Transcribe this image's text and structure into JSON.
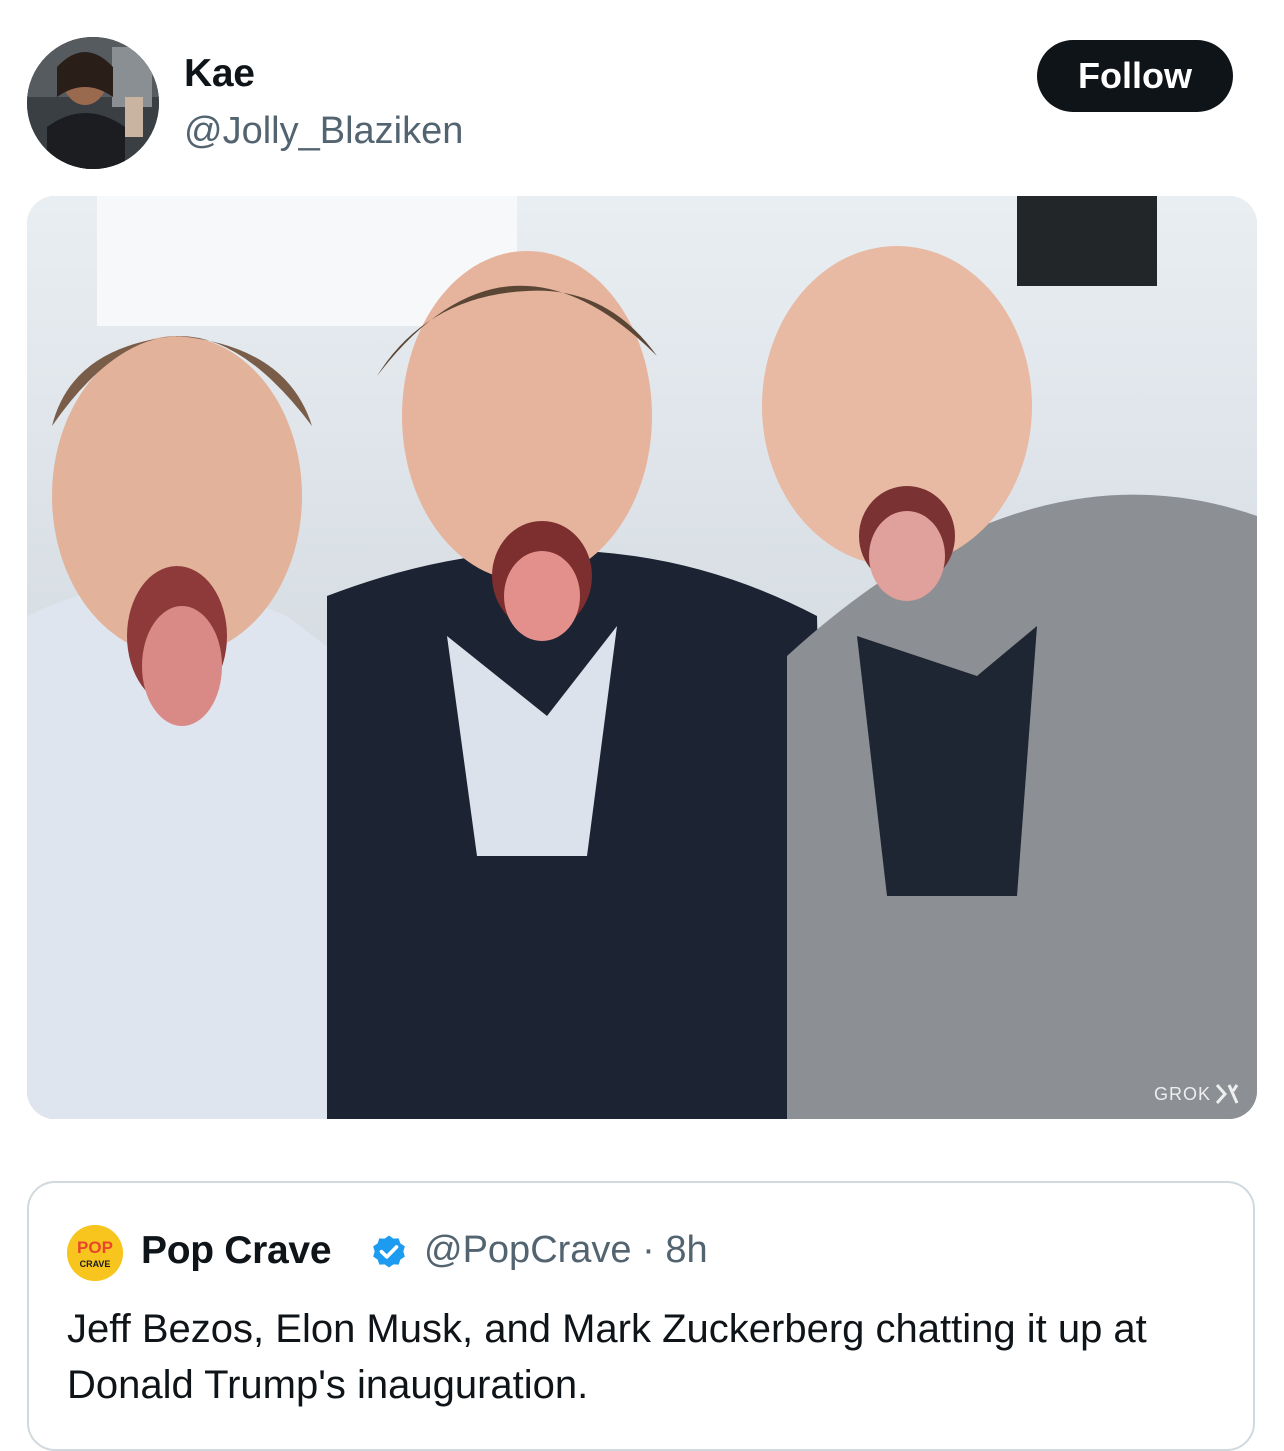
{
  "author": {
    "name": "Kae",
    "handle": "@Jolly_Blaziken",
    "follow_label": "Follow"
  },
  "media": {
    "watermark": "GROK",
    "watermark_icon": "xai-logo-icon"
  },
  "quoted_post": {
    "logo_text_top": "POP",
    "logo_text_bottom": "CRAVE",
    "name": "Pop Crave",
    "verified_icon": "verified-badge-icon",
    "handle": "@PopCrave",
    "separator": "·",
    "time": "8h",
    "text": "Jeff Bezos, Elon Musk, and Mark Zuckerberg chatting it up at Donald Trump's inauguration."
  },
  "colors": {
    "follow_bg": "#0f1419",
    "secondary_text": "#536471",
    "verified": "#1d9bf0",
    "border": "#cfd9de"
  }
}
